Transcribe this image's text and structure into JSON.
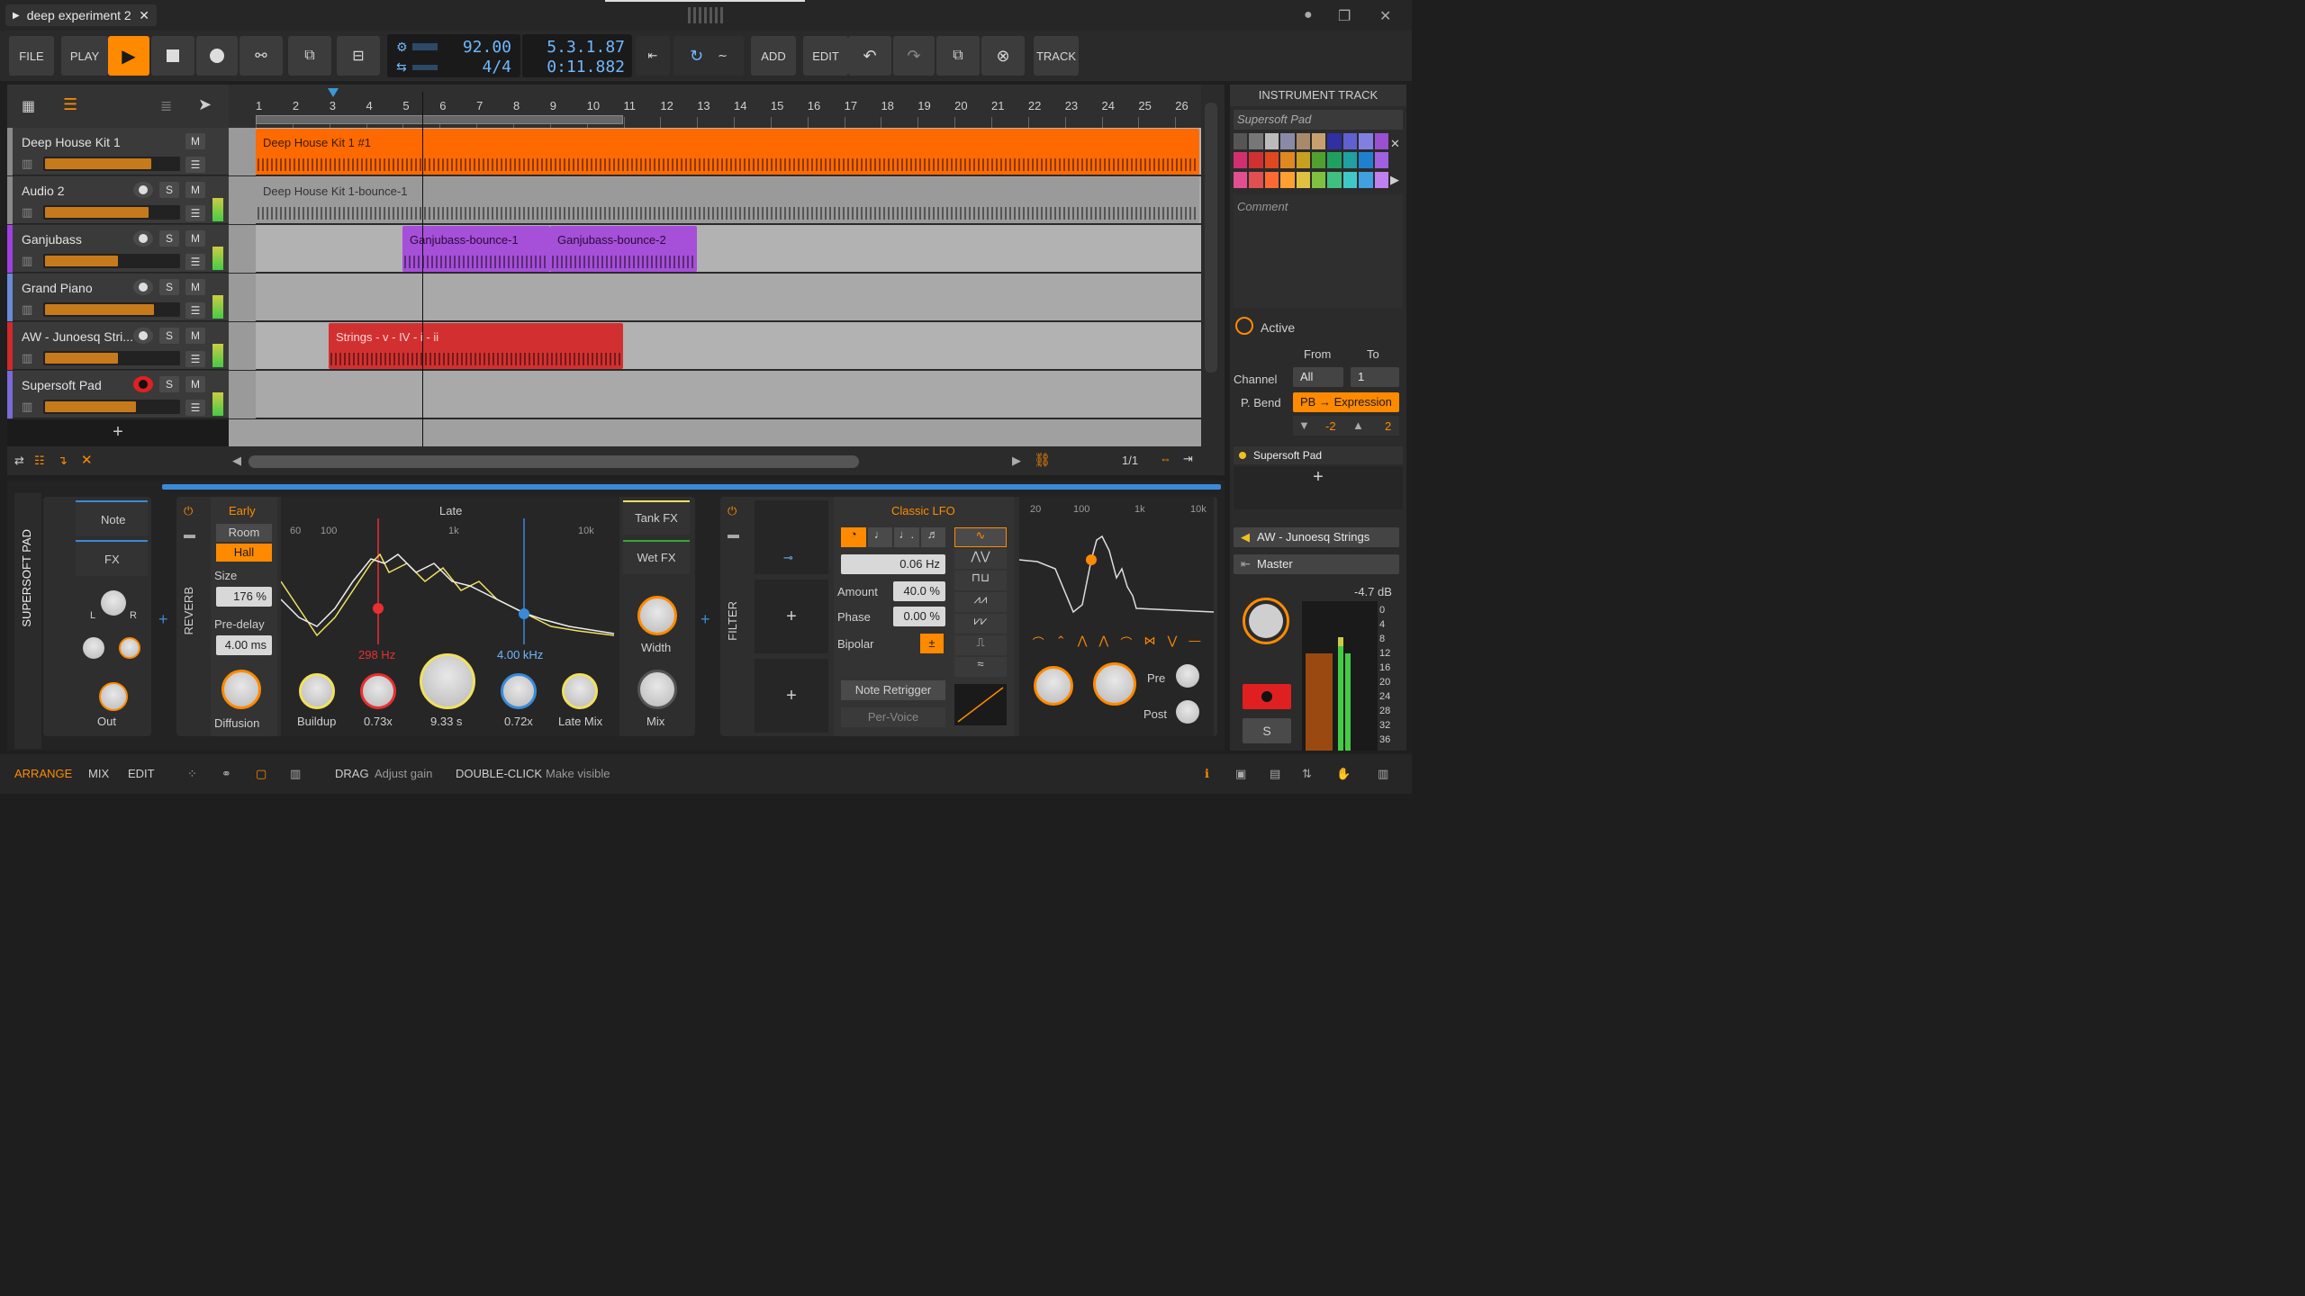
{
  "title": {
    "doc_name": "deep experiment 2"
  },
  "transport": {
    "file": "FILE",
    "play": "PLAY",
    "add": "ADD",
    "edit": "EDIT",
    "track": "TRACK",
    "tempo": "92.00",
    "signature": "4/4",
    "position": "5.3.1.87",
    "time": "0:11.882",
    "accent": "#ff8a00",
    "display_color": "#6fb8ff"
  },
  "ruler": {
    "bars": [
      "1",
      "2",
      "3",
      "4",
      "5",
      "6",
      "7",
      "8",
      "9",
      "10",
      "11",
      "12",
      "13",
      "14",
      "15",
      "16",
      "17",
      "18",
      "19",
      "20",
      "21",
      "22",
      "23",
      "24",
      "25",
      "26"
    ]
  },
  "tracks": [
    {
      "name": "Deep House Kit 1",
      "color": "#8a8a8a",
      "vol": 0.8,
      "buttons": [
        "M"
      ],
      "clips": [
        {
          "label": "Deep House Kit 1 #1",
          "start": 0,
          "end": 1048,
          "color": "#ff6a00",
          "text": "#3a1a00"
        }
      ]
    },
    {
      "name": "Audio 2",
      "color": "#8a8a8a",
      "vol": 0.78,
      "buttons": [
        "S",
        "M"
      ],
      "clips": [
        {
          "label": "Deep House Kit 1-bounce-1",
          "start": 0,
          "end": 1048,
          "color": "#9a9a9a",
          "text": "#333"
        }
      ]
    },
    {
      "name": "Ganjubass",
      "color": "#a040e0",
      "vol": 0.55,
      "buttons": [
        "S",
        "M"
      ],
      "clips": [
        {
          "label": "Ganjubass-bounce-1",
          "start": 163,
          "end": 327,
          "color": "#a64fd8",
          "text": "#2b0b3d"
        },
        {
          "label": "Ganjubass-bounce-2",
          "start": 327,
          "end": 490,
          "color": "#a64fd8",
          "text": "#2b0b3d"
        }
      ]
    },
    {
      "name": "Grand Piano",
      "color": "#6a8ad8",
      "vol": 0.82,
      "buttons": [
        "S",
        "M"
      ],
      "clips": []
    },
    {
      "name": "AW - Junoesq Stri...",
      "color": "#d02a2a",
      "vol": 0.55,
      "buttons": [
        "S",
        "M"
      ],
      "clips": [
        {
          "label": "Strings - v - IV - i - ii",
          "start": 81,
          "end": 408,
          "color": "#d23030",
          "text": "#ffd6d6"
        }
      ]
    },
    {
      "name": "Supersoft Pad",
      "color": "#7a6ad8",
      "vol": 0.68,
      "buttons": [
        "S",
        "M"
      ],
      "armed": true,
      "clips": []
    }
  ],
  "arranger_footer": {
    "zoom": "1/1"
  },
  "inspector": {
    "header": "INSTRUMENT TRACK",
    "track_name": "Supersoft Pad",
    "comment_placeholder": "Comment",
    "active": "Active",
    "from": "From",
    "to": "To",
    "channel": "Channel",
    "channel_from": "All",
    "channel_to": "1",
    "pbend": "P. Bend",
    "pbend_value": "PB → Expression",
    "pb_min": "-2",
    "pb_max": "2",
    "device_chip": "Supersoft Pad",
    "input": "AW - Junoesq Strings",
    "output": "Master",
    "level": "-4.7 dB",
    "meter_scale": [
      "0",
      "4",
      "8",
      "12",
      "16",
      "20",
      "24",
      "28",
      "32",
      "36"
    ],
    "palette": [
      "#555555",
      "#777777",
      "#bbbbbb",
      "#8a8aa8",
      "#a88a6a",
      "#c8a070",
      "#3030a0",
      "#6060d0",
      "#8080e0",
      "#9a50d0",
      "#d03070",
      "#d03030",
      "#e04820",
      "#e08820",
      "#c8a020",
      "#50a030",
      "#20a060",
      "#20a0a0",
      "#2080d0",
      "#a060e0",
      "#e05090",
      "#e05050",
      "#ff6a30",
      "#ffa030",
      "#e0c040",
      "#80c040",
      "#40c080",
      "#40c8c8",
      "#40a0e0",
      "#c080f0"
    ]
  },
  "devices": {
    "track_label": "SUPERSOFT PAD",
    "note": "Note",
    "fx": "FX",
    "out": "Out",
    "l": "L",
    "r": "R",
    "reverb": {
      "name": "REVERB",
      "early": "Early",
      "room": "Room",
      "hall": "Hall",
      "size_label": "Size",
      "size": "176 %",
      "predelay_label": "Pre-delay",
      "predelay": "4.00 ms",
      "diffusion": "Diffusion",
      "late": "Late",
      "freq_low": "298 Hz",
      "freq_high": "4.00 kHz",
      "buildup": "Buildup",
      "v073": "0.73x",
      "v933": "9.33 s",
      "v072": "0.72x",
      "late_mix": "Late Mix",
      "tank_fx": "Tank FX",
      "wet_fx": "Wet FX",
      "width": "Width",
      "mix": "Mix",
      "axis": [
        "60",
        "100",
        "1k",
        "10k"
      ]
    },
    "filter": {
      "name": "FILTER",
      "lfo": "Classic LFO",
      "rate": "0.06 Hz",
      "amount_label": "Amount",
      "amount": "40.0 %",
      "phase_label": "Phase",
      "phase": "0.00 %",
      "bipolar": "Bipolar",
      "bipolar_btn": "±",
      "note_retrigger": "Note Retrigger",
      "per_voice": "Per-Voice",
      "axis": [
        "20",
        "100",
        "1k",
        "10k"
      ],
      "pre": "Pre",
      "post": "Post"
    }
  },
  "statusbar": {
    "arrange": "ARRANGE",
    "mix": "MIX",
    "edit": "EDIT",
    "drag": "DRAG",
    "drag_hint": "Adjust gain",
    "dblclick": "DOUBLE-CLICK",
    "dblclick_hint": "Make visible"
  }
}
